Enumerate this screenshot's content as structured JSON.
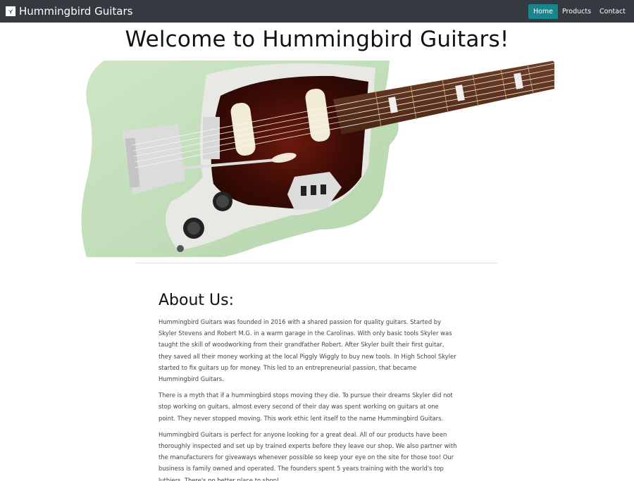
{
  "navbar": {
    "brand_text": "Hummingbird Guitars",
    "logo_icon": "hummingbird-logo-icon",
    "links": [
      {
        "label": "Home",
        "active": true
      },
      {
        "label": "Products",
        "active": false
      },
      {
        "label": "Contact",
        "active": false
      }
    ],
    "background_color": "#343a40",
    "active_color": "#17848e"
  },
  "hero": {
    "title": "Welcome to Hummingbird Guitars!",
    "image": "guitar-photo"
  },
  "about": {
    "heading": "About Us:",
    "paragraphs": [
      "Hummingbird Guitars was founded in 2016 with a shared passion for quality guitars. Started by Skyler Stevens and Robert M.G. in a warm garage in the Carolinas. With only basic tools Skyler was taught the skill of woodworking from their grandfather Robert. After Skyler built their first guitar, they saved all their money working at the local Piggly Wiggly to buy new tools. In High School Skyler started to fix guitars up for money. This led to an entrepreneurial passion, that became Hummingbird Guitars.",
      "There is a myth that if a hummingbird stops moving they die. To pursue their dreams Skyler did not stop working on guitars, almost every second of their day was spent working on guitars at one point. They never stopped moving. This work ethic lent itself to the name Hummingbird Guitars.",
      "Hummingbird Guitars is perfect for anyone looking for a great deal. All of our products have been thoroughly inspected and set up by trained experts before they leave our shop. We also partner with the manufacturers for giveaways whenever possible so keep your eye on the site for those too! Our business is family owned and operated. The founders spent 5 years training with the world's top luthiers. There's no better place to shop!"
    ]
  }
}
